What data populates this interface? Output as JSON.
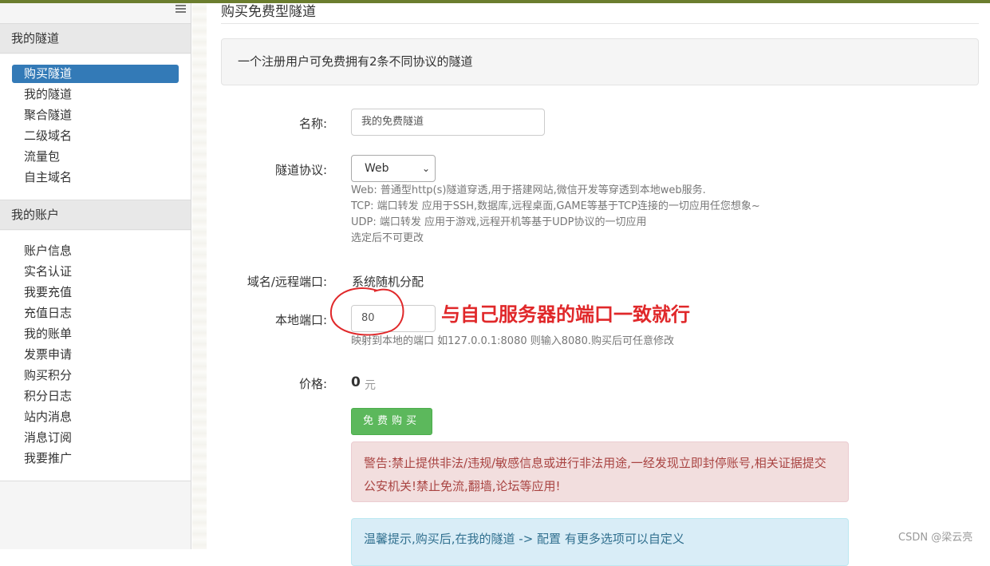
{
  "sidebar": {
    "section_tunnels": "我的隧道",
    "tunnel_items": [
      "购买隧道",
      "我的隧道",
      "聚合隧道",
      "二级域名",
      "流量包",
      "自主域名"
    ],
    "section_account": "我的账户",
    "account_items": [
      "账户信息",
      "实名认证",
      "我要充值",
      "充值日志",
      "我的账单",
      "发票申请",
      "购买积分",
      "积分日志",
      "站内消息",
      "消息订阅",
      "我要推广"
    ]
  },
  "main": {
    "title": "购买免费型隧道",
    "notice": "一个注册用户可免费拥有2条不同协议的隧道",
    "form": {
      "name_label": "名称:",
      "name_value": "我的免费隧道",
      "protocol_label": "隧道协议:",
      "protocol_value": "Web",
      "protocol_help": [
        "Web: 普通型http(s)隧道穿透,用于搭建网站,微信开发等穿透到本地web服务.",
        "TCP: 端口转发 应用于SSH,数据库,远程桌面,GAME等基于TCP连接的一切应用任您想象~",
        "UDP: 端口转发 应用于游戏,远程开机等基于UDP协议的一切应用",
        "选定后不可更改"
      ],
      "domain_label": "域名/远程端口:",
      "domain_value": "系统随机分配",
      "local_port_label": "本地端口:",
      "local_port_value": "80",
      "local_port_help": "映射到本地的端口 如127.0.0.1:8080 则输入8080.购买后可任意修改",
      "price_label": "价格:",
      "price_value": "0",
      "price_unit": "元",
      "buy_button": "免费购买"
    },
    "annotation": "与自己服务器的端口一致就行",
    "warning": "警告:禁止提供非法/违规/敏感信息或进行非法用途,一经发现立即封停账号,相关证据提交公安机关!禁止免流,翻墙,论坛等应用!",
    "tip": "温馨提示,购买后,在我的隧道 -> 配置 有更多选项可以自定义"
  },
  "watermark": "CSDN @梁云亮",
  "colors": {
    "active_nav": "#337ab7",
    "buy_button": "#5cb85c",
    "annotation": "#e0282a"
  }
}
